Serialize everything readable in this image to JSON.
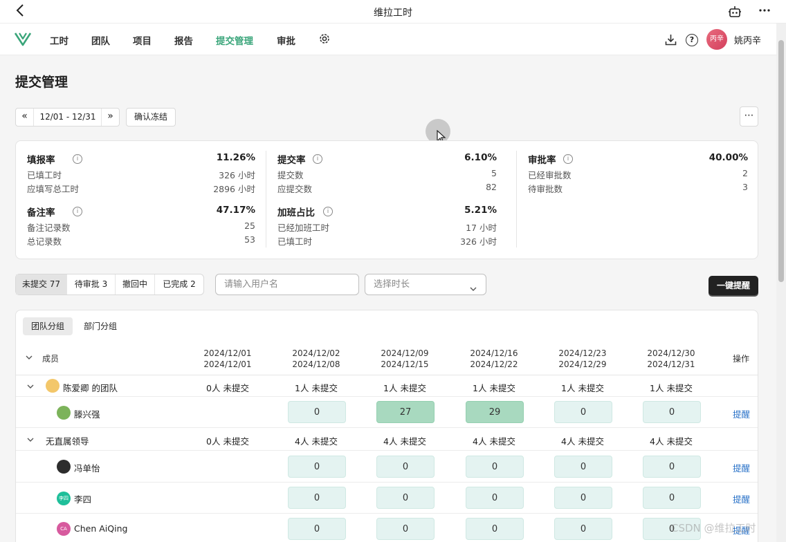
{
  "titlebar": {
    "back_icon": "back-arrow-icon",
    "title": "维拉工时"
  },
  "nav": {
    "items": [
      {
        "label": "工时",
        "active": false
      },
      {
        "label": "团队",
        "active": false
      },
      {
        "label": "项目",
        "active": false
      },
      {
        "label": "报告",
        "active": false
      },
      {
        "label": "提交管理",
        "active": true
      },
      {
        "label": "审批",
        "active": false
      }
    ],
    "accent": "#3aa57a",
    "help_glyph": "?",
    "user": {
      "avatar_text": "丙辛",
      "name": "姚丙辛"
    }
  },
  "page": {
    "title": "提交管理"
  },
  "toolbar": {
    "prev_glyph": "«",
    "next_glyph": "»",
    "date_range": "12/01 - 12/31",
    "confirm_freeze": "确认冻结",
    "more_glyph": "⋯"
  },
  "stats": {
    "fill_rate": {
      "name": "填报率",
      "value": "11.26%",
      "rows": [
        {
          "k": "已填工时",
          "v": "326 小时"
        },
        {
          "k": "应填写总工时",
          "v": "2896 小时"
        }
      ]
    },
    "submit_rate": {
      "name": "提交率",
      "value": "6.10%",
      "rows": [
        {
          "k": "提交数",
          "v": "5"
        },
        {
          "k": "应提交数",
          "v": "82"
        }
      ]
    },
    "approve_rate": {
      "name": "审批率",
      "value": "40.00%",
      "rows": [
        {
          "k": "已经审批数",
          "v": "2"
        },
        {
          "k": "待审批数",
          "v": "3"
        }
      ]
    },
    "note_rate": {
      "name": "备注率",
      "value": "47.17%",
      "rows": [
        {
          "k": "备注记录数",
          "v": "25"
        },
        {
          "k": "总记录数",
          "v": "53"
        }
      ]
    },
    "overtime_ratio": {
      "name": "加班占比",
      "value": "5.21%",
      "rows": [
        {
          "k": "已经加班工时",
          "v": "17 小时"
        },
        {
          "k": "已填工时",
          "v": "326 小时"
        }
      ]
    },
    "info_glyph": "i"
  },
  "filters": {
    "tabs": [
      {
        "label": "未提交 77",
        "active": true
      },
      {
        "label": "待审批 3",
        "active": false
      },
      {
        "label": "撤回中",
        "active": false
      },
      {
        "label": "已完成 2",
        "active": false
      }
    ],
    "search_placeholder": "请输入用户名",
    "duration_placeholder": "选择时长",
    "remind_all": "一键提醒"
  },
  "table": {
    "group_tabs": [
      {
        "label": "团队分组",
        "active": true
      },
      {
        "label": "部门分组",
        "active": false
      }
    ],
    "member_header": "成员",
    "op_header": "操作",
    "columns": [
      {
        "start": "2024/12/01",
        "end": "2024/12/01"
      },
      {
        "start": "2024/12/02",
        "end": "2024/12/08"
      },
      {
        "start": "2024/12/09",
        "end": "2024/12/15"
      },
      {
        "start": "2024/12/16",
        "end": "2024/12/22"
      },
      {
        "start": "2024/12/23",
        "end": "2024/12/29"
      },
      {
        "start": "2024/12/30",
        "end": "2024/12/31"
      }
    ],
    "groups": [
      {
        "name": "陈爱卿 的团队",
        "summary": [
          "0人 未提交",
          "1人 未提交",
          "1人 未提交",
          "1人 未提交",
          "1人 未提交",
          "1人 未提交"
        ],
        "members": [
          {
            "name": "滕兴强",
            "avatar_text": "",
            "avatar_color": "#7cb35a",
            "values": [
              "0",
              "27",
              "29",
              "0",
              "0"
            ],
            "highlight": [
              false,
              true,
              true,
              false,
              false
            ],
            "action": "提醒"
          }
        ]
      },
      {
        "name": "无直属领导",
        "summary": [
          "0人 未提交",
          "4人 未提交",
          "4人 未提交",
          "4人 未提交",
          "4人 未提交",
          "4人 未提交"
        ],
        "members": [
          {
            "name": "冯单怡",
            "avatar_text": "",
            "avatar_color": "#2d2d2d",
            "values": [
              "0",
              "0",
              "0",
              "0",
              "0"
            ],
            "highlight": [
              false,
              false,
              false,
              false,
              false
            ],
            "action": "提醒"
          },
          {
            "name": "李四",
            "avatar_text": "李四",
            "avatar_color": "#1fbf9a",
            "values": [
              "0",
              "0",
              "0",
              "0",
              "0"
            ],
            "highlight": [
              false,
              false,
              false,
              false,
              false
            ],
            "action": "提醒"
          },
          {
            "name": "Chen AiQing",
            "avatar_text": "CA",
            "avatar_color": "#d75a9e",
            "values": [
              "0",
              "0",
              "0",
              "0",
              "0"
            ],
            "highlight": [
              false,
              false,
              false,
              false,
              false
            ],
            "action": "提醒"
          }
        ]
      }
    ],
    "remind_color": "#2a72c8"
  },
  "watermark": "CSDN @维拉工时"
}
